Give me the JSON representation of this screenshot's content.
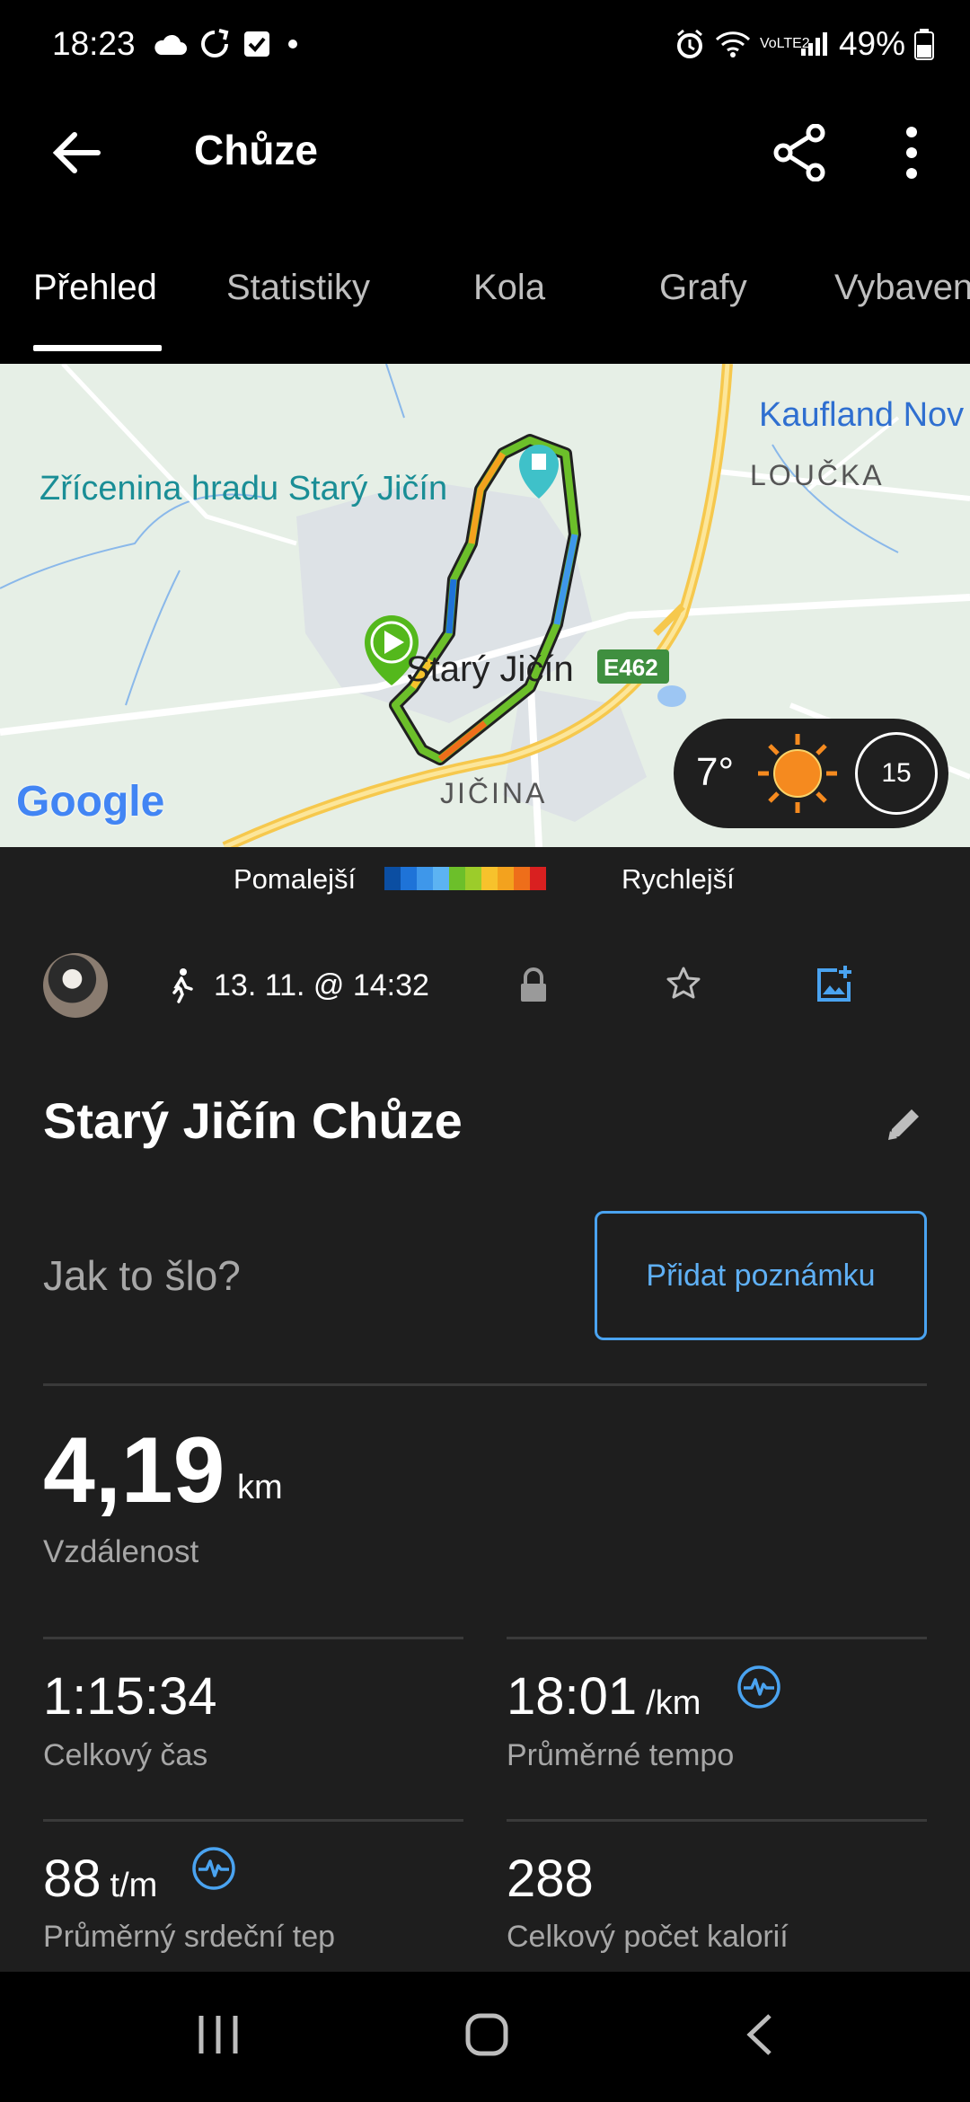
{
  "status": {
    "time": "18:23",
    "battery": "49%",
    "network": "VoLTE2"
  },
  "app_bar": {
    "title": "Chůze"
  },
  "tabs": [
    {
      "label": "Přehled",
      "active": true
    },
    {
      "label": "Statistiky"
    },
    {
      "label": "Kola"
    },
    {
      "label": "Grafy"
    },
    {
      "label": "Vybaven"
    }
  ],
  "map": {
    "labels": {
      "castle": "Zřícenina hradu Starý Jičín",
      "kaufland": "Kaufland Nov",
      "loucka": "LOUČKA",
      "town": "Starý Jičín",
      "road": "E462",
      "jicina": "JIČINA",
      "google": "Google"
    },
    "weather": {
      "temperature": "7°",
      "wind": "15"
    }
  },
  "legend": {
    "slow": "Pomalejší",
    "fast": "Rychlejší",
    "colors": [
      "#0b4ea2",
      "#1e73d8",
      "#3e97ea",
      "#5cb3f2",
      "#6cbf2a",
      "#9ccc2a",
      "#f7c22c",
      "#f3a21e",
      "#ee6e1a",
      "#d92020"
    ]
  },
  "activity": {
    "datetime": "13. 11. @ 14:32",
    "title": "Starý Jičín Chůze",
    "how_prompt": "Jak to šlo?",
    "add_note": "Přidat poznámku"
  },
  "stats": {
    "distance": {
      "value": "4,19",
      "unit": "km",
      "label": "Vzdálenost"
    },
    "total_time": {
      "value": "1:15:34",
      "label": "Celkový čas"
    },
    "avg_pace": {
      "value": "18:01",
      "unit": "/km",
      "label": "Průměrné tempo"
    },
    "avg_hr": {
      "value": "88",
      "unit": "t/m",
      "label": "Průměrný srdeční tep"
    },
    "calories": {
      "value": "288",
      "label": "Celkový počet kalorií"
    }
  },
  "colors": {
    "accent": "#4aa3f0",
    "background": "#1e1e1e"
  }
}
